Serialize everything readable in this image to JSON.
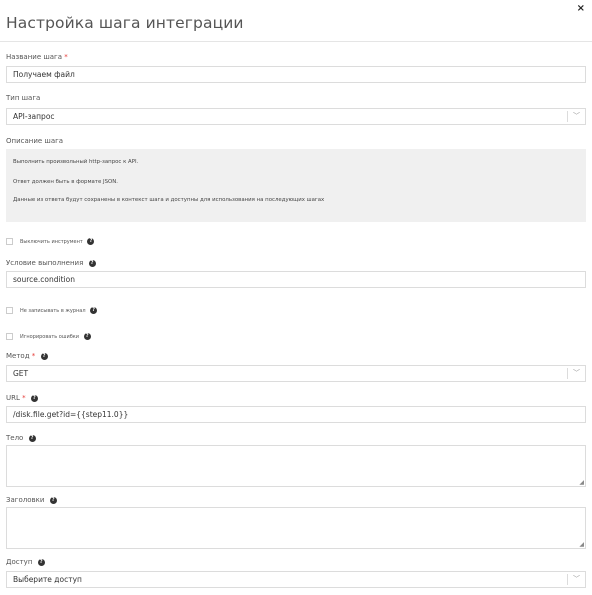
{
  "header": {
    "title": "Настройка шага интеграции",
    "close": "×"
  },
  "fields": {
    "step_name": {
      "label": "Название шага",
      "required": "*",
      "value": "Получаем файл"
    },
    "step_type": {
      "label": "Тип шага",
      "value": "API-запрос"
    },
    "description": {
      "label": "Описание шага",
      "lines": [
        "Выполнить произвольный http-запрос к API.",
        "Ответ должен быть в формате JSON.",
        "Данные из ответа будут сохранены в контекст шага и доступны для использования на последующих шагах"
      ]
    },
    "disable_tool": {
      "label": "Выключить инструмент"
    },
    "condition": {
      "label": "Условие выполнения",
      "value": "source.condition"
    },
    "no_log": {
      "label": "Не записывать в журнал"
    },
    "ignore_errors": {
      "label": "Игнорировать ошибки"
    },
    "method": {
      "label": "Метод",
      "required": "*",
      "value": "GET"
    },
    "url": {
      "label": "URL",
      "required": "*",
      "value": "/disk.file.get?id={{step11.0}}"
    },
    "body": {
      "label": "Тело"
    },
    "headers": {
      "label": "Заголовки"
    },
    "access": {
      "label": "Доступ",
      "placeholder": "Выберите доступ"
    }
  },
  "icons": {
    "help": "question-circle-icon",
    "chevron": "chevron-down-icon",
    "close": "close-icon",
    "resize": "resize-grip-icon"
  }
}
